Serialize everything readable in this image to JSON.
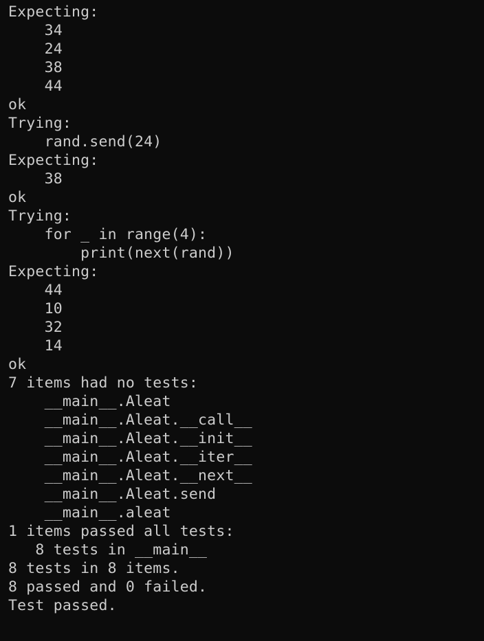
{
  "terminal": {
    "background": "#0c0c0c",
    "foreground": "#cccccc",
    "lines": [
      "Expecting:",
      "    34",
      "    24",
      "    38",
      "    44",
      "ok",
      "Trying:",
      "    rand.send(24)",
      "Expecting:",
      "    38",
      "ok",
      "Trying:",
      "    for _ in range(4):",
      "        print(next(rand))",
      "Expecting:",
      "    44",
      "    10",
      "    32",
      "    14",
      "ok",
      "7 items had no tests:",
      "    __main__.Aleat",
      "    __main__.Aleat.__call__",
      "    __main__.Aleat.__init__",
      "    __main__.Aleat.__iter__",
      "    __main__.Aleat.__next__",
      "    __main__.Aleat.send",
      "    __main__.aleat",
      "1 items passed all tests:",
      "   8 tests in __main__",
      "8 tests in 8 items.",
      "8 passed and 0 failed.",
      "Test passed."
    ]
  }
}
